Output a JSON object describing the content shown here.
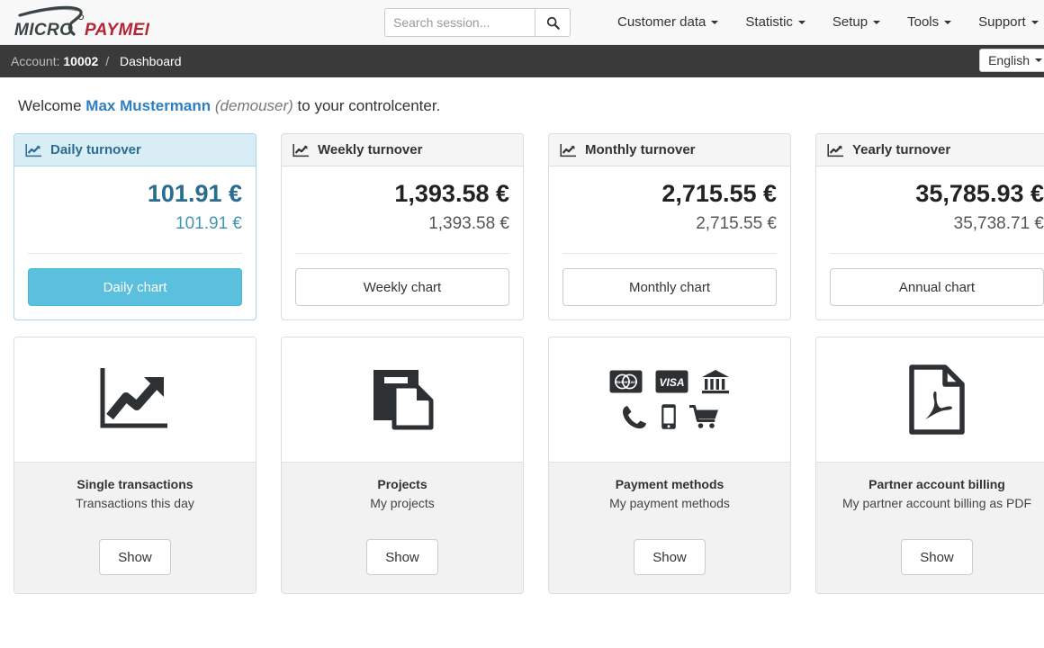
{
  "brand": {
    "word_one": "MICRO",
    "word_two": "PAYMENT",
    "color_dark": "#3b4347",
    "color_red": "#b52433"
  },
  "search": {
    "placeholder": "Search session...",
    "value": "",
    "icon": "search-icon"
  },
  "nav": {
    "items": [
      {
        "label": "Customer data",
        "has_caret": true
      },
      {
        "label": "Statistic",
        "has_caret": true
      },
      {
        "label": "Setup",
        "has_caret": true
      },
      {
        "label": "Tools",
        "has_caret": true
      },
      {
        "label": "Support",
        "has_caret": true
      }
    ],
    "user": {
      "icon": "user-icon",
      "glyph": "☗",
      "has_caret": true
    }
  },
  "breadcrumb": {
    "account_label": "Account:",
    "account_number": "10002",
    "separator": "/",
    "page": "Dashboard"
  },
  "language": {
    "selected": "English",
    "icon": "chevron-down-icon"
  },
  "welcome": {
    "prefix": "Welcome",
    "name": "Max Mustermann",
    "handle": "(demouser)",
    "suffix": "to your controlcenter."
  },
  "turnover_cards": [
    {
      "title": "Daily turnover",
      "amount_main": "101.91 €",
      "amount_sub": "101.91 €",
      "button": "Daily chart",
      "icon": "line-chart-icon",
      "active": true
    },
    {
      "title": "Weekly turnover",
      "amount_main": "1,393.58 €",
      "amount_sub": "1,393.58 €",
      "button": "Weekly chart",
      "icon": "line-chart-icon",
      "active": false
    },
    {
      "title": "Monthly turnover",
      "amount_main": "2,715.55 €",
      "amount_sub": "2,715.55 €",
      "button": "Monthly chart",
      "icon": "line-chart-icon",
      "active": false
    },
    {
      "title": "Yearly turnover",
      "amount_main": "35,785.93 €",
      "amount_sub": "35,738.71 €",
      "button": "Annual chart",
      "icon": "line-chart-icon",
      "active": false
    }
  ],
  "feature_cards": [
    {
      "title": "Single transactions",
      "subtitle": "Transactions this day",
      "button": "Show",
      "icon": "growth-chart-icon"
    },
    {
      "title": "Projects",
      "subtitle": "My projects",
      "button": "Show",
      "icon": "documents-copy-icon"
    },
    {
      "title": "Payment methods",
      "subtitle": "My payment methods",
      "button": "Show",
      "icon": "payment-methods-icons",
      "payment_icons": [
        "mastercard-icon",
        "visa-icon",
        "bank-icon",
        "phone-icon",
        "mobile-icon",
        "shopping-cart-icon"
      ],
      "visa_label": "VISA",
      "mastercard_label": "MasterCard"
    },
    {
      "title": "Partner account billing",
      "subtitle": "My partner account billing as PDF",
      "button": "Show",
      "icon": "pdf-file-icon"
    }
  ],
  "colors": {
    "accent_blue": "#5bc0de",
    "active_header": "#d9edf7",
    "active_text": "#2a6d8f",
    "link_blue": "#2e7fc1",
    "dark_bar": "#3a3a3a"
  }
}
